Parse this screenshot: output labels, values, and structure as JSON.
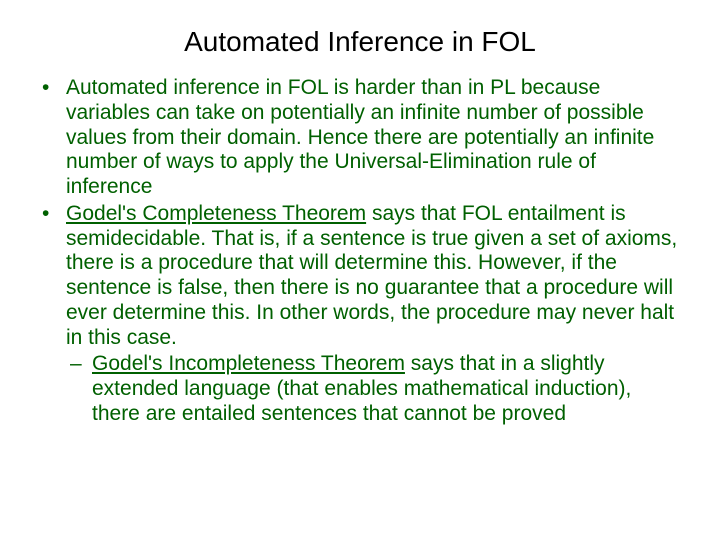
{
  "title": "Automated Inference in FOL",
  "bullet1": "Automated inference in FOL is harder than in PL because variables can take on potentially an infinite number of possible values from their domain. Hence there are potentially an infinite number of ways to apply the Universal-Elimination rule of inference",
  "bullet2_underlined": "Godel's Completeness Theorem",
  "bullet2_rest": " says that FOL entailment is semidecidable. That is, if a sentence is true given a set of axioms, there is a procedure that will determine this. However, if the sentence is false, then there is no guarantee that a procedure will ever determine this.  In other words, the procedure may never halt in this case.",
  "sub_underlined": "Godel's Incompleteness Theorem",
  "sub_rest": " says that in a slightly extended language (that enables mathematical induction), there are entailed sentences that cannot be proved"
}
